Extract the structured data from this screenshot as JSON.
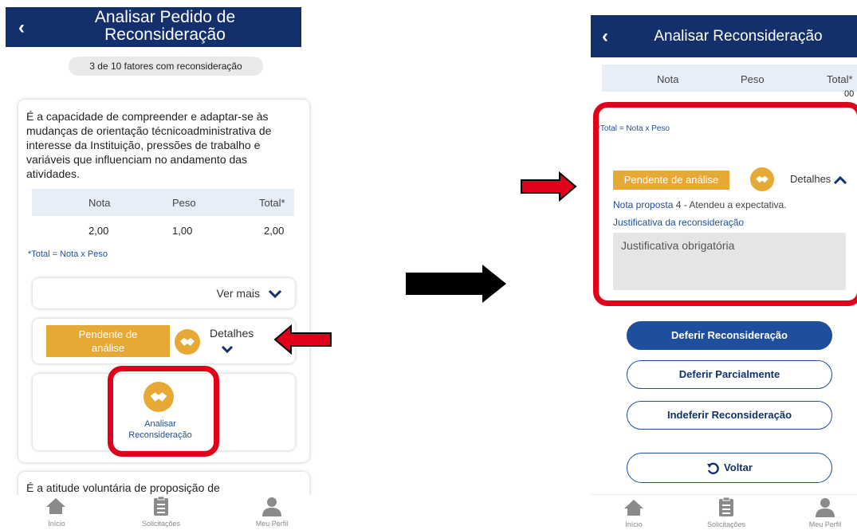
{
  "left": {
    "header_title": "Analisar Pedido de Reconsideração",
    "back_glyph": "‹",
    "factor_counter": "3 de 10 fatores com reconsideração",
    "factor_description": "É a capacidade de compreender e adaptar-se às mudanças de orientação técnicoadministrativa de interesse da Instituição, pressões de trabalho e variáveis que influenciam no andamento das atividades.",
    "table_headers": [
      "Nota",
      "Peso",
      "Total*"
    ],
    "table_values": [
      "2,00",
      "1,00",
      "2,00"
    ],
    "total_note": "*Total = Nota x Peso",
    "ver_mais_label": "Ver mais",
    "pending_label": "Pendente de análise",
    "detalhes_label": "Detalhes",
    "analisar_label": "Analisar Reconsideração",
    "next_factor_text": "É a atitude voluntária de proposição de"
  },
  "right": {
    "header_title": "Analisar Reconsideração",
    "back_glyph": "‹",
    "table_headers": [
      "Nota",
      "Peso",
      "Total*"
    ],
    "partial_value": "00",
    "total_note": "*Total = Nota x Peso",
    "pending_label": "Pendente de análise",
    "detalhes_label": "Detalhes",
    "nota_proposta_label": "Nota proposta",
    "nota_proposta_value": "4 - Atendeu a expectativa.",
    "justificativa_label": "Justificativa da reconsideração",
    "justificativa_placeholder": "Justificativa obrigatória",
    "btn_deferir": "Deferir Reconsideração",
    "btn_parcial": "Deferir Parcialmente",
    "btn_indeferir": "Indeferir Reconsideração",
    "btn_voltar": "Voltar"
  },
  "bottom_nav": [
    "Início",
    "Solicitações",
    "Meu Perfil"
  ],
  "icons": {
    "home": "home-icon",
    "clipboard": "clipboard-icon",
    "profile": "user-icon",
    "handshake": "handshake-icon",
    "chevron": "chevron-down-icon",
    "undo": "undo-icon"
  },
  "colors": {
    "header": "#13306c",
    "accent_blue": "#1f4e9c",
    "pending_orange": "#e7a935",
    "highlight_red": "#e1001a",
    "table_head": "#e7eef8"
  }
}
